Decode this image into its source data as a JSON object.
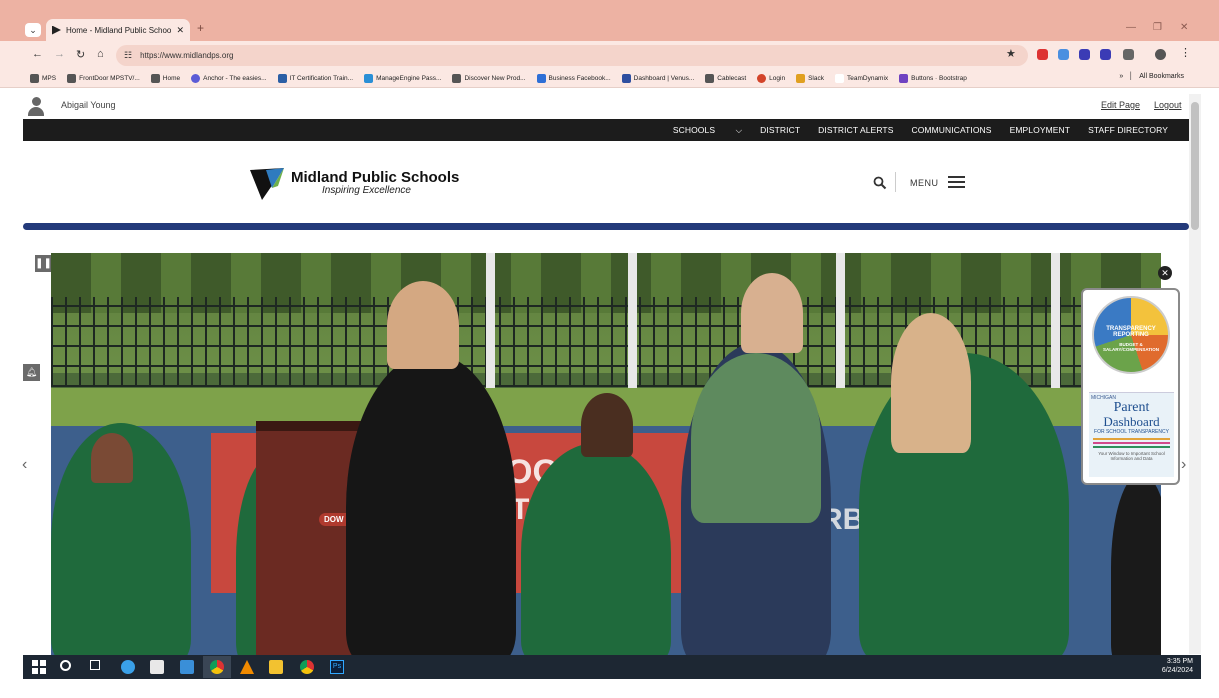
{
  "browser": {
    "tab_title": "Home - Midland Public Schools",
    "url": "https://www.midlandps.org",
    "bookmarks": [
      "MPS",
      "FrontDoor MPSTV/...",
      "Home",
      "Anchor - The easies...",
      "IT Certification Train...",
      "ManageEngine Pass...",
      "Discover New Prod...",
      "Business Facebook...",
      "Dashboard | Venus...",
      "Cablecast",
      "Login",
      "Slack",
      "TeamDynamix",
      "Buttons · Bootstrap"
    ],
    "all_bookmarks_label": "All Bookmarks",
    "overflow_label": "»"
  },
  "admin_bar": {
    "user_name": "Abigail Young",
    "edit_page": "Edit Page",
    "logout": "Logout"
  },
  "top_nav": {
    "items": [
      "SCHOOLS",
      "DISTRICT",
      "DISTRICT ALERTS",
      "COMMUNICATIONS",
      "EMPLOYMENT",
      "STAFF DIRECTORY"
    ]
  },
  "header": {
    "brand": "Midland Public Schools",
    "tagline": "Inspiring Excellence",
    "menu_label": "MENU"
  },
  "widget": {
    "seal_text": "TRANSPARENCY REPORTING",
    "seal_sub": "BUDGET & SALARY/COMPENSATION",
    "pd_state": "MICHIGAN",
    "pd_title1": "Parent",
    "pd_title2": "Dashboard",
    "pd_sub": "FOR SCHOOL TRANSPARENCY",
    "pd_foot": "Your Window to Important School Information and Data"
  },
  "hero": {
    "wall_text_1": "OON",
    "wall_text_2": "STA",
    "wall_text_3": "RBE",
    "podium_text": "DOW DIAMOND"
  },
  "taskbar": {
    "time": "3:35 PM",
    "date": "6/24/2024"
  },
  "colors": {
    "tab_strip": "#edb2a3",
    "nav_bar": "#1c1c1c",
    "accent_rule": "#233a7a",
    "gown_green": "#1f6a3c"
  }
}
